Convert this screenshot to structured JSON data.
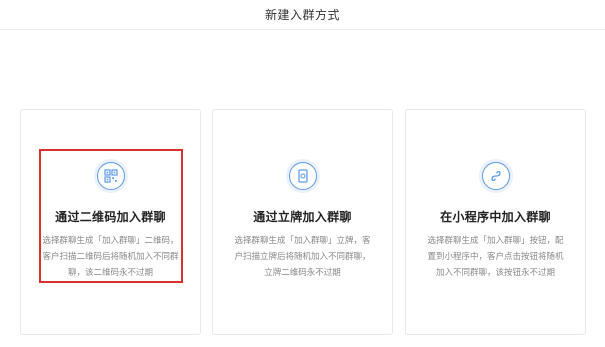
{
  "header": {
    "title": "新建入群方式"
  },
  "cards": [
    {
      "title": "通过二维码加入群聊",
      "description": "选择群聊生成「加入群聊」二维码，客户扫描二维码后将随机加入不同群聊，该二维码永不过期",
      "icon": "qrcode-icon",
      "selected": true
    },
    {
      "title": "通过立牌加入群聊",
      "description": "选择群聊生成「加入群聊」立牌，客户扫描立牌后将随机加入不同群聊，立牌二维码永不过期",
      "icon": "standee-icon",
      "selected": false
    },
    {
      "title": "在小程序中加入群聊",
      "description": "选择群聊生成「加入群聊」按钮，配置到小程序中，客户点击按钮将随机加入不同群聊，该按钮永不过期",
      "icon": "miniprogram-icon",
      "selected": false
    }
  ],
  "colors": {
    "accent": "#5a9ae8",
    "icon_background": "#eaf1fb",
    "selection_border": "#d9312b",
    "card_border": "#e8e8e8",
    "description_text": "#888888"
  }
}
